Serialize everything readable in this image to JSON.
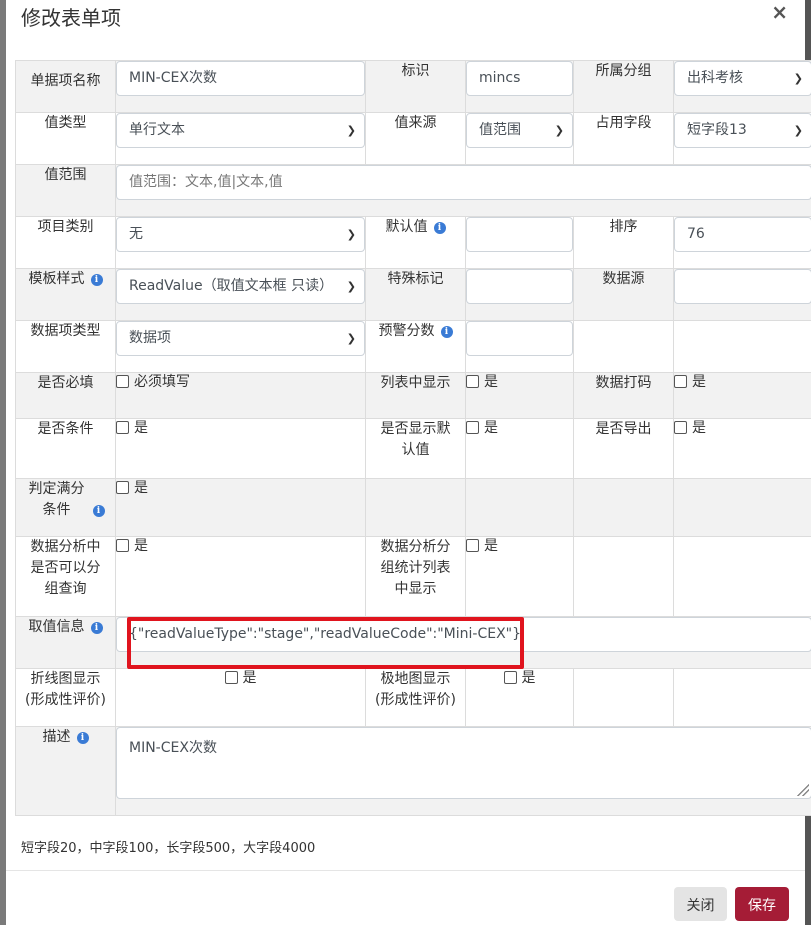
{
  "dialog": {
    "title": "修改表单项",
    "close_symbol": "×"
  },
  "rows": {
    "r1": {
      "name_label": "单据项名称",
      "name_value": "MIN-CEX次数",
      "id_label": "标识",
      "id_value": "mincs",
      "group_label": "所属分组",
      "group_value": "出科考核"
    },
    "r2": {
      "valtype_label": "值类型",
      "valtype_value": "单行文本",
      "valsrc_label": "值来源",
      "valsrc_value": "值范围",
      "field_label": "占用字段",
      "field_value": "短字段13"
    },
    "r3": {
      "range_label": "值范围",
      "range_placeholder": "值范围：文本,值|文本,值"
    },
    "r4": {
      "category_label": "项目类别",
      "category_value": "无",
      "default_label": "默认值",
      "default_value": "",
      "order_label": "排序",
      "order_value": "76"
    },
    "r5": {
      "template_label": "模板样式",
      "template_value": "ReadValue（取值文本框 只读）",
      "special_label": "特殊标记",
      "special_value": "",
      "datasource_label": "数据源",
      "datasource_value": ""
    },
    "r6": {
      "itemtype_label": "数据项类型",
      "itemtype_value": "数据项",
      "warning_label": "预警分数",
      "warning_value": ""
    },
    "r7": {
      "required_label": "是否必填",
      "required_check": "必须填写",
      "listshow_label": "列表中显示",
      "listshow_check": "是",
      "mask_label": "数据打码",
      "mask_check": "是"
    },
    "r8": {
      "condition_label": "是否条件",
      "condition_check": "是",
      "showdefault_label": "是否显示默认值",
      "showdefault_check": "是",
      "export_label": "是否导出",
      "export_check": "是"
    },
    "r9": {
      "fullscore_label": "判定满分条件",
      "fullscore_check": "是"
    },
    "r10": {
      "groupquery_label": "数据分析中是否可以分组查询",
      "groupquery_check": "是",
      "groupstat_label": "数据分析分组统计列表中显示",
      "groupstat_check": "是"
    },
    "r11": {
      "readinfo_label": "取值信息",
      "readinfo_value": "{\"readValueType\":\"stage\",\"readValueCode\":\"Mini-CEX\"}"
    },
    "r12": {
      "linechart_label": "折线图显示(形成性评价)",
      "linechart_check": "是",
      "polar_label": "极地图显示(形成性评价)",
      "polar_check": "是"
    },
    "r13": {
      "desc_label": "描述",
      "desc_value": "MIN-CEX次数"
    }
  },
  "footnote": "短字段20，中字段100，长字段500，大字段4000",
  "footer": {
    "close_label": "关闭",
    "save_label": "保存"
  },
  "icons": {
    "info": "info-circle-icon",
    "chevron": "chevron-down-icon"
  },
  "colors": {
    "save_button": "#a51c36",
    "highlight_box": "#e0141e",
    "info_icon": "#3a7bd5"
  }
}
